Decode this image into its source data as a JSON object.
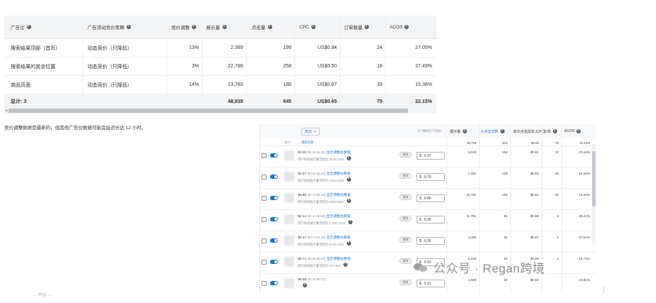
{
  "placement_table": {
    "headers": [
      "广告位",
      "广告活动竞价策略",
      "竞价调整",
      "展示量",
      "点击量",
      "CPC",
      "订单数量",
      "ACOS"
    ],
    "rows": [
      {
        "placement": "搜索结果顶部（首页）",
        "strategy": "动态竞价（只降低）",
        "adjust": "13%",
        "impressions": "2,369",
        "clicks": "199",
        "cpc": "US$0.84",
        "orders": "24",
        "acos": "27.05%"
      },
      {
        "placement": "搜索结果的其余位置",
        "strategy": "动态竞价（只降低）",
        "adjust": "3%",
        "impressions": "22,786",
        "clicks": "258",
        "cpc": "US$0.50",
        "orders": "18",
        "acos": "27.49%"
      },
      {
        "placement": "商品页面",
        "strategy": "动态竞价（只降低）",
        "adjust": "14%",
        "impressions": "23,783",
        "clicks": "188",
        "cpc": "US$0.67",
        "orders": "33",
        "acos": "15.38%"
      }
    ],
    "total": {
      "label": "总计: 3",
      "impressions": "48,938",
      "clicks": "645",
      "cpc": "US$0.65",
      "orders": "75",
      "acos": "22.15%"
    },
    "scroll_arrow": "◂"
  },
  "note": "竞价调整数据是最新的，但其他广告位数据可能会延迟长达 12 小时。",
  "keyword_table": {
    "filter_label": "本日 ∨",
    "filter_hint": "5个细则在下活动",
    "total_label": "总计:",
    "total_link": "规则全部",
    "headers": [
      "展示量",
      "▾ 点击次数",
      "单次点击成本 (CPC)",
      "订单",
      "ACOS"
    ],
    "total": {
      "impressions": "48,719",
      "clicks": "644",
      "cpc": "$0.65",
      "orders": "75",
      "acos": "22.14%"
    },
    "rows": [
      {
        "bid_text": "$1.00",
        "range": "($0.00-$1.52)",
        "link": "显示调整估算值",
        "range2": "预计每周展示量范围为 3010-1325",
        "pill": "规则",
        "currency": "$",
        "bid": "0.37",
        "impressions": "5,519",
        "clicks": "158",
        "cpc": "$0.51",
        "orders": "13",
        "acos": "23.44%"
      },
      {
        "bid_text": "$1.07",
        "range": "($0.61-$1.54)",
        "link": "显示调整估算值",
        "range2": "预计每周展示量范围为 3464-5198",
        "pill": "规则",
        "currency": "$",
        "bid": "0.79",
        "impressions": "7,281",
        "clicks": "139",
        "cpc": "$0.83",
        "orders": "29",
        "acos": "16.26%"
      },
      {
        "bid_text": "$0.99",
        "range": "($0.74-$1.26)",
        "link": "显示调整估算值",
        "range2": "预计每周展示量范围为 5940-5852",
        "pill": "规则",
        "currency": "$",
        "bid": "0.86",
        "impressions": "10,781",
        "clicks": "102",
        "cpc": "$0.91",
        "orders": "20",
        "acos": "16.20%"
      },
      {
        "bid_text": "$2.14",
        "range": "($1.61-$3.66)",
        "link": "显示调整估算值",
        "range2": "预计每周展示量范围为 2,235-3,535",
        "pill": "规则",
        "currency": "$",
        "bid": "0.35",
        "impressions": "11,791",
        "clicks": "65",
        "cpc": "$0.59",
        "orders": "4",
        "acos": "36.21%"
      },
      {
        "bid_text": "$0.67",
        "range": "($0.76-$1.08)",
        "link": "显示调整估算值",
        "range2": "预计每周展示量范围为 8710-1315",
        "pill": "规则",
        "currency": "$",
        "bid": "0.26",
        "impressions": "4,095",
        "clicks": "36",
        "cpc": "$0.57",
        "orders": "2",
        "acos": "37.61%"
      },
      {
        "bid_text": "$0.71",
        "range": "($0.58-$0.89)",
        "link": "显示调整估算值",
        "range2": "预计每周展示量范围为 347-958",
        "pill": "规则",
        "currency": "$",
        "bid": "0.52",
        "impressions": "1,229",
        "clicks": "34",
        "cpc": "$0.50",
        "orders": "4",
        "acos": "16.72%"
      },
      {
        "bid_text": "$0.59",
        "range": "($0.44-$0.74)",
        "link": "",
        "range2": "--",
        "pill": "规则",
        "currency": "$",
        "bid": "0.21",
        "impressions": "1,828",
        "clicks": "32",
        "cpc": "$0.52",
        "orders": "",
        "acos": "43.81%"
      }
    ]
  },
  "watermark": "公众号 · Regan跨境",
  "footnote": "... 中止 ..."
}
